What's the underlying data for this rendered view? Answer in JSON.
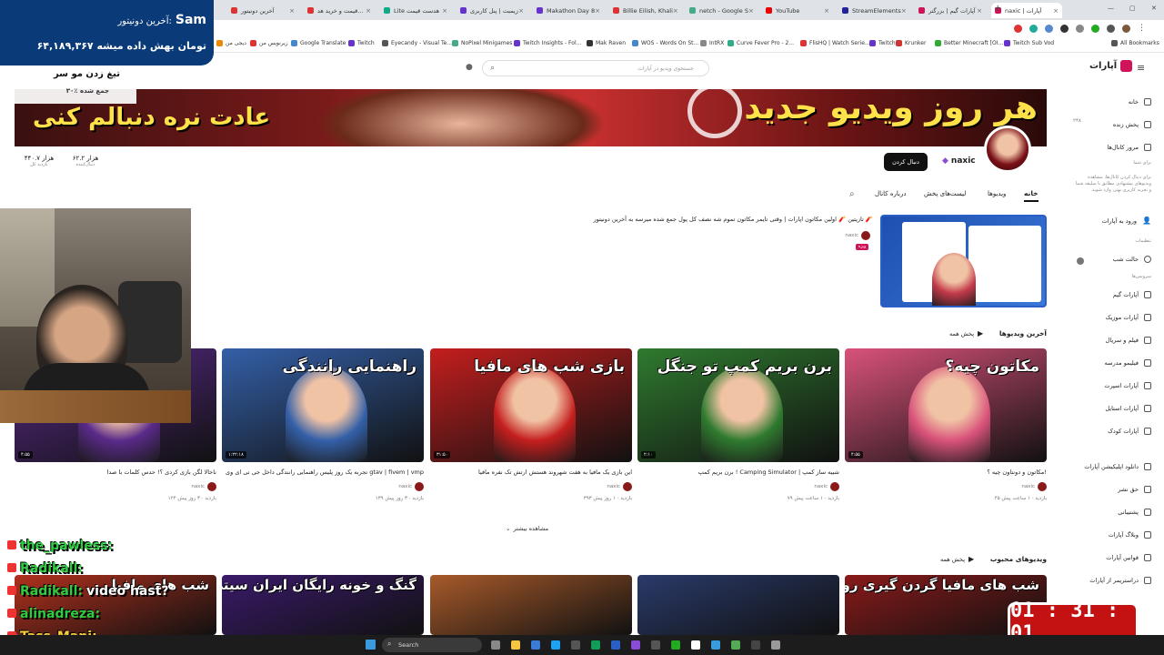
{
  "browser": {
    "tabs": [
      {
        "label": "آخرین دونیتور",
        "color": "#d33"
      },
      {
        "label": "قیمت و خرید هد...",
        "color": "#d33"
      },
      {
        "label": "Lite هدست قیمت",
        "color": "#1a8"
      },
      {
        "label": "زیمبت | پنل کاربری",
        "color": "#63c"
      },
      {
        "label": "Makathon Day 8",
        "color": "#63c"
      },
      {
        "label": "Billie Eilish, Khali",
        "color": "#d33"
      },
      {
        "label": "netch - Google S",
        "color": "#4a8"
      },
      {
        "label": "YouTube",
        "color": "#e00"
      },
      {
        "label": "StreamElements",
        "color": "#229"
      },
      {
        "label": "آپارات گیم | بزرگتر",
        "color": "#d0145a"
      },
      {
        "label": "naxic | آپارات",
        "color": "#d0145a"
      }
    ],
    "bookmarks": [
      "All Bookmarks",
      "Twitch Sub Vod",
      "Better Minecraft [OI...",
      "Krunker",
      "Twitch",
      "FlisHQ | Watch Serie...",
      "Curve Fever Pro - 2...",
      "IntRX",
      "WOS - Words On St...",
      "Mak Raven",
      "Twitch Insights - Fol...",
      "NoPixel Minigames",
      "Eyecandy - Visual Te...",
      "Twitch",
      "Google Translate",
      "زیرنویس من",
      "دیجی من"
    ]
  },
  "header": {
    "logo": "آپارات",
    "search_placeholder": "جستجوی ویدیو در آپارات"
  },
  "banner": {
    "line1": "هر روز ویدیو جدید",
    "line2": "عادت نره دنبالم کنی"
  },
  "channel": {
    "name": "naxic",
    "follow_label": "دنبال کردن",
    "stats": [
      {
        "value": "۶۲.۲ هزار",
        "label": "دنبال‌کننده"
      },
      {
        "value": "۴۴۰.۷ هزار",
        "label": "بازدید کل"
      }
    ],
    "tabs": [
      "خانه",
      "ویدیوها",
      "لیست‌های پخش",
      "درباره کانال"
    ]
  },
  "featured": {
    "title": "تازیتین 🧨 اولین مکاتون اپارات | وقتی تایمر مکاتون تموم شه نصف کل پول جمع شده میرسه به آخرین دونیتور 🧨",
    "author": "naxic",
    "badge": "ویژه"
  },
  "sections": [
    {
      "title": "آخرین ویدیوها",
      "play_all": "پخش همه"
    },
    {
      "title": "ویدیوهای محبوب",
      "play_all": "پخش همه"
    }
  ],
  "videos": [
    {
      "title": "مکاتون و دونتاون چیه ؟!",
      "author": "naxic",
      "meta": "۴۵ بازدید · ۱ ساعت پیش",
      "dur": "۴:۵۵",
      "thumb_text": "مکاتون چیه؟",
      "color": "#d9527a"
    },
    {
      "title": "برن بریم کمپ ! Camping Simulator | شبیه ساز کمپ",
      "author": "naxic",
      "meta": "۷۹ بازدید · ۱ ساعت پیش",
      "dur": "۲:۱۰",
      "thumb_text": "برن بریم کمپ تو جنگل",
      "color": "#2f7a2f"
    },
    {
      "title": "این بازی یک مافیا به هفت شهروند هستش ارتش تک نفره مافیا",
      "author": "naxic",
      "meta": "۳۹۳ بازدید · ۱ روز پیش",
      "dur": "۳۱:۵۰",
      "thumb_text": "بازی شب های مافیا",
      "color": "#c41e1e"
    },
    {
      "title": "تجربه یک روز پلیس راهنمایی رانندگی داخل جی تی ای وی gtav | fivem | vmp",
      "author": "naxic",
      "meta": "۱۳۹ بازدید · ۳ روز پیش",
      "dur": "۱:۲۲:۱۸",
      "thumb_text": "راهنمایی رانندگی",
      "color": "#3460a8"
    },
    {
      "title": "ناخالا لگن بازی کردی ؟! حدس کلمات با صدا",
      "author": "naxic",
      "meta": "۱۲۴ بازدید · ۳ روز پیش",
      "dur": "۴:۵۵",
      "thumb_text": "",
      "color": "#5a2a8a"
    }
  ],
  "popular": [
    {
      "thumb_text": "شب های مافیا گردن گیری روز اول",
      "color": "#8a1a1a"
    },
    {
      "thumb_text": "",
      "color": "#2a3a6a"
    },
    {
      "thumb_text": "",
      "color": "#a85a2a"
    },
    {
      "thumb_text": "گنگ و خونه رایگان ایران سیتی",
      "color": "#3a1a6a"
    },
    {
      "thumb_text": "شب های مافیا",
      "color": "#b0301e"
    }
  ],
  "more_label": "مشاهده بیشتر",
  "sidebar": {
    "items": [
      "خانه",
      "پخش زنده",
      "مرور کانال‌ها"
    ],
    "live_count": "۲۴۸",
    "hint_title": "برای شما",
    "hint": "برای دنبال کردن کانال‌ها، مشاهده ویدیوهای پیشنهادی مطابق با سلیقه شما و تجربه کاربری بهتر، وارد شوید.",
    "login": "ورود به آپارات",
    "settings_label": "تنظیمات",
    "night_mode": "حالت شب",
    "services_label": "سرویس‌ها",
    "services": [
      "آپارات گیم",
      "آپارات موزیک",
      "فیلم و سریال",
      "فیلیمو مدرسه",
      "آپارات اسپرت",
      "آپارات استایل",
      "آپارات کودک"
    ],
    "footer": [
      "دانلود اپلیکیشن آپارات",
      "حق نشر",
      "پشتیبانی",
      "وبلاگ آپارات",
      "قوانین آپارات",
      "دراستریمر از آپارات"
    ]
  },
  "overlay": {
    "last_donor_label": "آخرین دونیتور:",
    "last_donor_name": "Sam",
    "amount_line": "۶۴,۱۸۹,۳۶۷ تومان بهش داده میشه",
    "sub_title": "تیغ زدن مو سر",
    "sub_line": "۳۰٪ جمع شده"
  },
  "chat": [
    {
      "user": "the_pawless:",
      "text": "",
      "color": "#2ecc40"
    },
    {
      "user": "Radikall:",
      "text": "",
      "color": "#2ecc40"
    },
    {
      "user": "Radikall:",
      "text": "video hast?",
      "color": "#2ecc40"
    },
    {
      "user": "alinadreza:",
      "text": "",
      "color": "#2ecc40"
    },
    {
      "user": "Tass_Mani:",
      "text": "",
      "color": "#f4d03f"
    }
  ],
  "timer": "01 : 31 : 01",
  "taskbar": {
    "search": "Search"
  }
}
